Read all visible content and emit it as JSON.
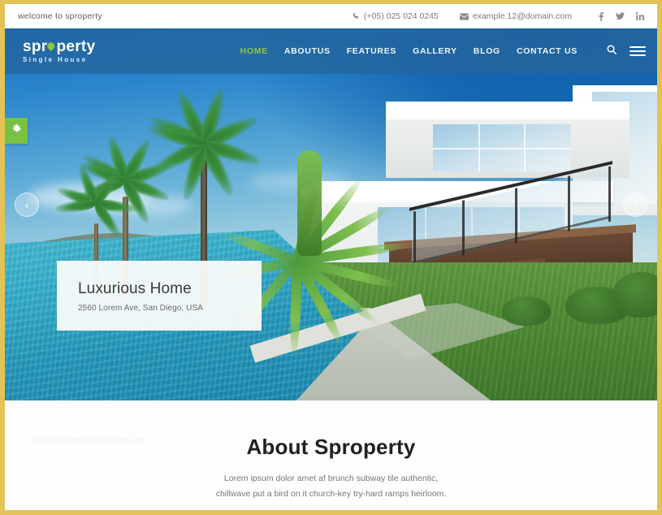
{
  "topbar": {
    "welcome": "welcome to sproperty",
    "phone": "(+05) 025 024 0245",
    "email": "example.12@domain.com",
    "phone_icon": "phone-icon",
    "email_icon": "envelope-icon",
    "socials": [
      {
        "name": "facebook",
        "glyph": "f"
      },
      {
        "name": "twitter",
        "glyph": "t"
      },
      {
        "name": "linkedin",
        "glyph": "in"
      }
    ]
  },
  "header": {
    "logo_main": "sproperty",
    "logo_main_pre": "spr",
    "logo_main_post": "perty",
    "logo_sub": "Single House",
    "nav": [
      {
        "label": "HOME",
        "active": true
      },
      {
        "label": "ABOUTUS",
        "active": false
      },
      {
        "label": "FEATURES",
        "active": false
      },
      {
        "label": "GALLERY",
        "active": false
      },
      {
        "label": "BLOG",
        "active": false
      },
      {
        "label": "CONTACT US",
        "active": false
      }
    ],
    "search_icon": "search-icon",
    "menu_icon": "hamburger-menu-icon",
    "accent_color": "#8cc63e",
    "bar_color": "#24659c"
  },
  "hero": {
    "settings_icon": "gear-icon",
    "prev_label": "‹",
    "next_label": "›",
    "caption": {
      "title": "Luxurious Home",
      "address": "2560 Lorem Ave, San Diego, USA"
    }
  },
  "about": {
    "title": "About Sproperty",
    "paragraph_line1": "Lorem ipsum dolor amet af brunch subway tile authentic, chillwave put a",
    "paragraph_line2": "bird on it church-key try-hard ramps heirloom.",
    "watermark": "www.freetemplatesonline.com"
  },
  "theme": {
    "frame_color": "#e3c355",
    "green": "#79c143",
    "page_bg": "#fdfdfd"
  }
}
